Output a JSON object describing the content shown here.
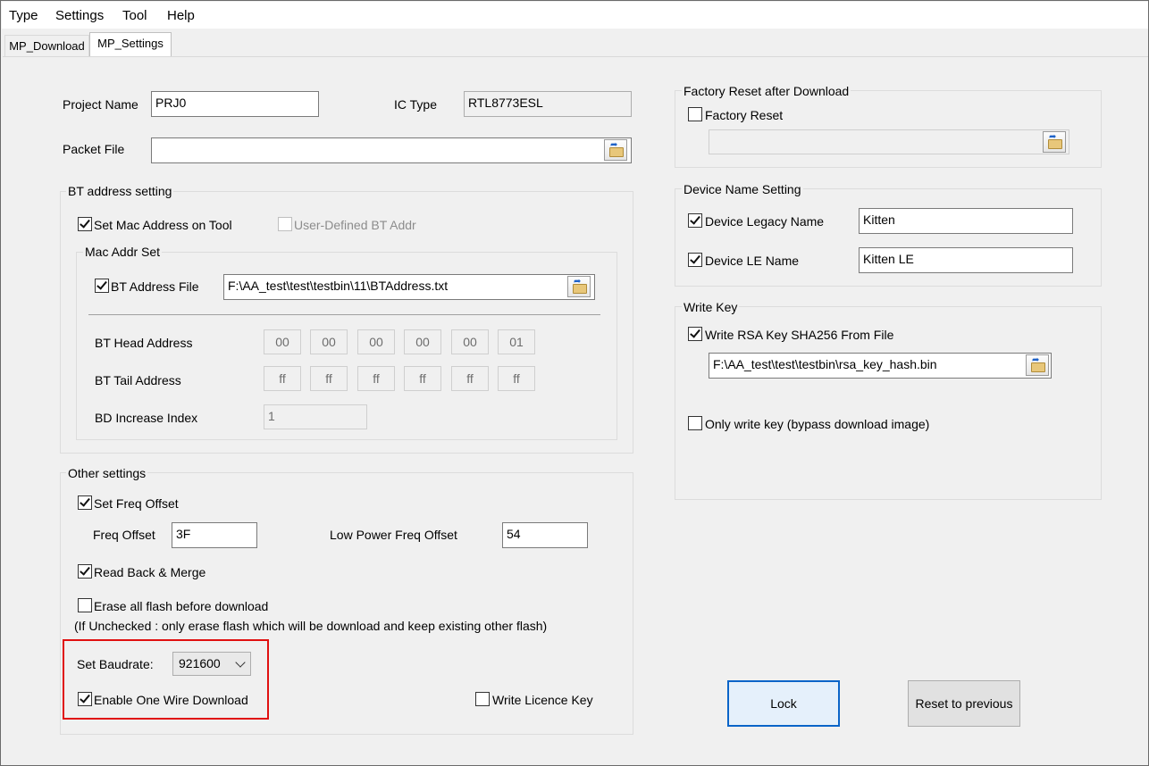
{
  "menu": {
    "items": [
      {
        "label": "Type"
      },
      {
        "label": "Settings"
      },
      {
        "label": "Tool"
      },
      {
        "label": "Help"
      }
    ]
  },
  "tabs": [
    {
      "label": "MP_Download"
    },
    {
      "label": "MP_Settings"
    }
  ],
  "project": {
    "name_label": "Project Name",
    "name_value": "PRJ0",
    "ic_label": "IC Type",
    "ic_value": "RTL8773ESL",
    "packet_label": "Packet File",
    "packet_value": ""
  },
  "bt_address": {
    "title": "BT address setting",
    "set_mac_label": "Set Mac Address on Tool",
    "set_mac_checked": true,
    "user_defined_label": "User-Defined BT Addr",
    "user_defined_checked": false,
    "mac_addr_set": {
      "title": "Mac Addr Set",
      "file_label": "BT Address File",
      "file_checked": true,
      "file_path": "F:\\AA_test\\test\\testbin\\11\\BTAddress.txt",
      "head_label": "BT Head Address",
      "head_bytes": [
        "00",
        "00",
        "00",
        "00",
        "00",
        "01"
      ],
      "tail_label": "BT Tail Address",
      "tail_bytes": [
        "ff",
        "ff",
        "ff",
        "ff",
        "ff",
        "ff"
      ],
      "increase_label": "BD Increase Index",
      "increase_value": "1"
    }
  },
  "other": {
    "title": "Other settings",
    "freq_offset_check_label": "Set Freq Offset",
    "freq_offset_checked": true,
    "freq_offset_label": "Freq Offset",
    "freq_offset_value": "3F",
    "low_power_label": "Low Power Freq Offset",
    "low_power_value": "54",
    "read_back_label": "Read Back & Merge",
    "read_back_checked": true,
    "erase_label": "Erase all flash before download",
    "erase_checked": false,
    "erase_note": "(If Unchecked : only erase flash which will be download and keep existing other flash)",
    "baudrate_label": "Set Baudrate:",
    "baudrate_value": "921600",
    "one_wire_label": "Enable One Wire Download",
    "one_wire_checked": true,
    "licence_label": "Write Licence Key",
    "licence_checked": false
  },
  "factory_reset": {
    "title": "Factory Reset after Download",
    "check_label": "Factory Reset",
    "checked": false,
    "path_value": ""
  },
  "device_name": {
    "title": "Device Name Setting",
    "legacy_label": "Device Legacy Name",
    "legacy_checked": true,
    "legacy_value": "Kitten",
    "le_label": "Device LE Name",
    "le_checked": true,
    "le_value": "Kitten LE"
  },
  "write_key": {
    "title": "Write Key",
    "rsa_label": "Write RSA Key SHA256 From File",
    "rsa_checked": true,
    "rsa_path": "F:\\AA_test\\test\\testbin\\rsa_key_hash.bin",
    "only_key_label": "Only write key (bypass download image)",
    "only_key_checked": false
  },
  "buttons": {
    "lock_label": "Lock",
    "reset_label": "Reset to previous"
  },
  "colors": {
    "highlight": "#e01010",
    "default_button_border": "#0a64c8"
  }
}
